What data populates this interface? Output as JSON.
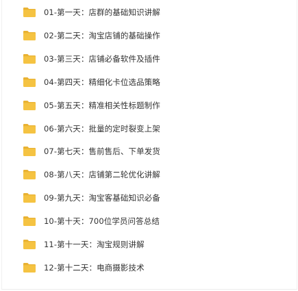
{
  "colors": {
    "folder_body": "#f5c342",
    "folder_tab": "#e9b233",
    "text": "#333333"
  },
  "file_list": {
    "items": [
      {
        "icon": "folder-icon",
        "name": "01-第一天：店群的基础知识讲解"
      },
      {
        "icon": "folder-icon",
        "name": "02-第二天：淘宝店铺的基础操作"
      },
      {
        "icon": "folder-icon",
        "name": "03-第三天：店铺必备软件及插件"
      },
      {
        "icon": "folder-icon",
        "name": "04-第四天：精细化卡位选品策略"
      },
      {
        "icon": "folder-icon",
        "name": "05-第五天：精准相关性标题制作"
      },
      {
        "icon": "folder-icon",
        "name": "06-第六天：批量的定时裂变上架"
      },
      {
        "icon": "folder-icon",
        "name": "07-第七天：售前售后、下单发货"
      },
      {
        "icon": "folder-icon",
        "name": "08-第八天：店铺第二轮优化讲解"
      },
      {
        "icon": "folder-icon",
        "name": "09-第九天：淘宝客基础知识必备"
      },
      {
        "icon": "folder-icon",
        "name": "10-第十天：700位学员问答总结"
      },
      {
        "icon": "folder-icon",
        "name": "11-第十一天：淘宝规则讲解"
      },
      {
        "icon": "folder-icon",
        "name": "12-第十二天：电商摄影技术"
      }
    ]
  }
}
